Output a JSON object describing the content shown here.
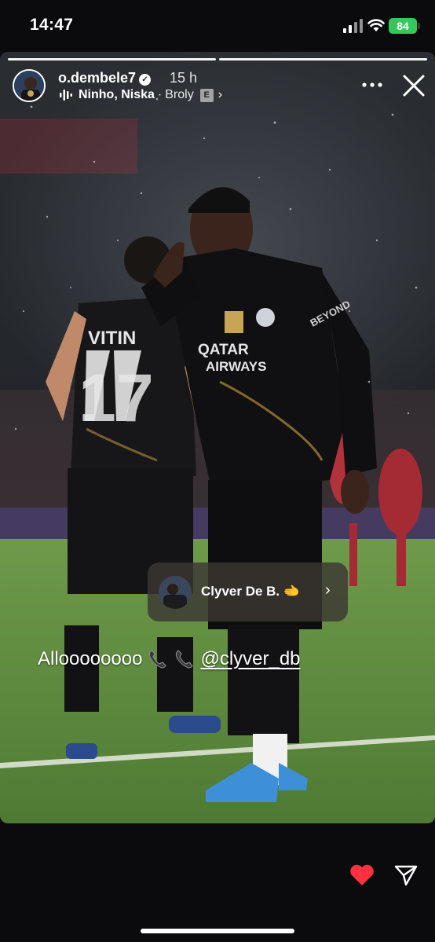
{
  "status_bar": {
    "time": "14:47",
    "battery": "84"
  },
  "story": {
    "username": "o.dembele7",
    "time_ago": "15 h",
    "music": {
      "artist": "Ninho, Niska",
      "separator": "·",
      "song": "Broly",
      "explicit_badge": "E"
    },
    "progress_segments": 2,
    "active_segment": 1,
    "mention_card": {
      "name": "Clyver De B.",
      "emoji": "🫲"
    },
    "caption": {
      "text": "Alloooooooo",
      "mention": "@clyver_db"
    }
  },
  "icons": {
    "more": "more-dots-icon",
    "close": "close-icon",
    "like": "heart-icon",
    "share": "send-icon"
  },
  "colors": {
    "battery": "#34c759",
    "heart": "#ff3040",
    "background": "#0b0b0d",
    "pitch": "#5f8d3f"
  }
}
